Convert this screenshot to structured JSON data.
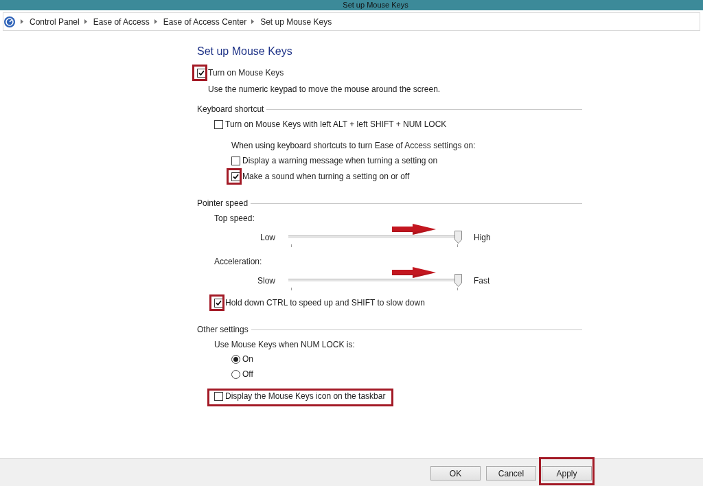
{
  "window": {
    "title": "Set up Mouse Keys"
  },
  "address_bar": {
    "breadcrumbs": [
      "Control Panel",
      "Ease of Access",
      "Ease of Access Center",
      "Set up Mouse Keys"
    ]
  },
  "heading": "Set up Mouse Keys",
  "main_option": {
    "label": "Turn on Mouse Keys",
    "checked": true,
    "box_highlighted": true
  },
  "description": "Use the numeric keypad to move the mouse around the screen.",
  "sections": [
    {
      "title": "Keyboard shortcut",
      "items": [
        {
          "kind": "checkbox",
          "label": "Turn on Mouse Keys with left ALT + left SHIFT + NUM LOCK",
          "checked": false,
          "children": [
            {
              "kind": "text",
              "label": "When using keyboard shortcuts to turn Ease of Access settings on:"
            },
            {
              "kind": "checkbox",
              "label": "Display a warning message when turning a setting on",
              "checked": false
            },
            {
              "kind": "checkbox",
              "label": "Make a sound when turning a setting on or off",
              "checked": true,
              "box_highlighted": true
            }
          ]
        }
      ]
    },
    {
      "title": "Pointer speed",
      "items": [
        {
          "kind": "slider",
          "label": "Top speed:",
          "min_label": "Low",
          "max_label": "High",
          "level": 1,
          "arrow": true
        },
        {
          "kind": "slider",
          "label": "Acceleration:",
          "min_label": "Slow",
          "max_label": "Fast",
          "level": 1,
          "arrow": true
        },
        {
          "kind": "checkbox",
          "label": "Hold down CTRL to speed up and SHIFT to slow down",
          "checked": true,
          "box_highlighted": true
        }
      ]
    },
    {
      "title": "Other settings",
      "items": [
        {
          "kind": "radio_group",
          "label": "Use Mouse Keys when NUM LOCK is:",
          "options": [
            {
              "label": "On",
              "selected": true
            },
            {
              "label": "Off",
              "selected": false
            }
          ]
        },
        {
          "kind": "checkbox",
          "label": "Display the Mouse Keys icon on the taskbar",
          "checked": false,
          "row_highlighted": true
        }
      ]
    }
  ],
  "buttons": [
    {
      "label": "OK"
    },
    {
      "label": "Cancel"
    },
    {
      "label": "Apply",
      "highlighted": true
    }
  ]
}
